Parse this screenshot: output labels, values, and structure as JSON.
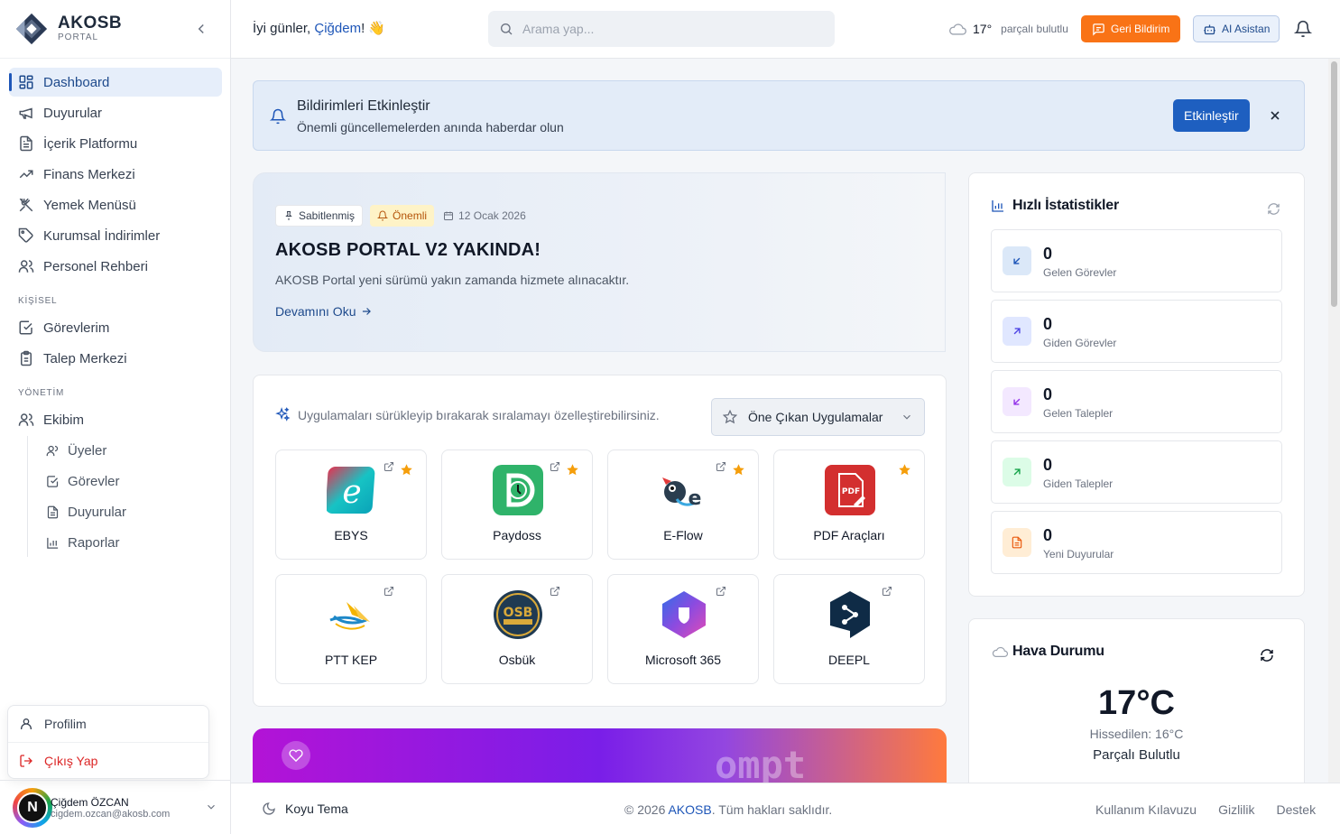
{
  "brand": {
    "name": "AKOSB",
    "sub": "PORTAL"
  },
  "sidebar": {
    "items": [
      {
        "label": "Dashboard"
      },
      {
        "label": "Duyurular"
      },
      {
        "label": "İçerik Platformu"
      },
      {
        "label": "Finans Merkezi"
      },
      {
        "label": "Yemek Menüsü"
      },
      {
        "label": "Kurumsal İndirimler"
      },
      {
        "label": "Personel Rehberi"
      }
    ],
    "section_personal": "KİŞİSEL",
    "personal_items": [
      {
        "label": "Görevlerim"
      },
      {
        "label": "Talep Merkezi"
      }
    ],
    "section_management": "YÖNETİM",
    "team": {
      "label": "Ekibim"
    },
    "team_sub": [
      {
        "label": "Üyeler"
      },
      {
        "label": "Görevler"
      },
      {
        "label": "Duyurular"
      },
      {
        "label": "Raporlar"
      }
    ]
  },
  "profile_menu": {
    "profile": "Profilim",
    "logout": "Çıkış Yap"
  },
  "user": {
    "initial": "N",
    "name": "Çiğdem ÖZCAN",
    "email": "cigdem.ozcan@akosb.com"
  },
  "topbar": {
    "greeting_prefix": "İyi günler, ",
    "greeting_name": "Çiğdem",
    "greeting_suffix": "! 👋",
    "search_placeholder": "Arama yap...",
    "weather_temp": "17°",
    "weather_cond": "parçalı bulutlu",
    "feedback_label": "Geri Bildirim",
    "ai_label": "AI Asistan"
  },
  "notification_banner": {
    "title": "Bildirimleri Etkinleştir",
    "subtitle": "Önemli güncellemelerden anında haberdar olun",
    "button": "Etkinleştir"
  },
  "announcement": {
    "tag_pinned": "Sabitlenmiş",
    "tag_important": "Önemli",
    "date": "12 Ocak 2026",
    "title": "AKOSB PORTAL V2 YAKINDA!",
    "body": "AKOSB Portal yeni sürümü yakın zamanda hizmete alınacaktır.",
    "link": "Devamını Oku"
  },
  "apps": {
    "hint": "Uygulamaları sürükleyip bırakarak sıralamayı özelleştirebilirsiniz.",
    "select_value": "Öne Çıkan Uygulamalar",
    "items": [
      {
        "name": "EBYS",
        "starred": true
      },
      {
        "name": "Paydoss",
        "starred": true
      },
      {
        "name": "E-Flow",
        "starred": true
      },
      {
        "name": "PDF Araçları",
        "starred": true
      },
      {
        "name": "PTT KEP",
        "starred": false
      },
      {
        "name": "Osbük",
        "starred": false
      },
      {
        "name": "Microsoft 365",
        "starred": false
      },
      {
        "name": "DEEPL",
        "starred": false
      }
    ]
  },
  "promo": {
    "text": "ompt"
  },
  "stats": {
    "title": "Hızlı İstatistikler",
    "items": [
      {
        "value": "0",
        "label": "Gelen Görevler",
        "color": "#1e56b8",
        "bg": "#dbe8f8"
      },
      {
        "value": "0",
        "label": "Giden Görevler",
        "color": "#4f46e5",
        "bg": "#e0e7ff"
      },
      {
        "value": "0",
        "label": "Gelen Talepler",
        "color": "#9333ea",
        "bg": "#f3e8ff"
      },
      {
        "value": "0",
        "label": "Giden Talepler",
        "color": "#16a34a",
        "bg": "#dcfce7"
      },
      {
        "value": "0",
        "label": "Yeni Duyurular",
        "color": "#ea580c",
        "bg": "#ffedd5"
      }
    ]
  },
  "weather": {
    "title": "Hava Durumu",
    "temp": "17°C",
    "feels": "Hissedilen: 16°C",
    "condition": "Parçalı Bulutlu"
  },
  "footer": {
    "theme": "Koyu Tema",
    "copyright_prefix": "© 2026 ",
    "copyright_brand": "AKOSB",
    "copyright_suffix": ". Tüm hakları saklıdır.",
    "links": [
      "Kullanım Kılavuzu",
      "Gizlilik",
      "Destek"
    ]
  },
  "colors": {
    "primary": "#1e56b8",
    "accent_orange": "#f97316",
    "star": "#f59e0b"
  }
}
